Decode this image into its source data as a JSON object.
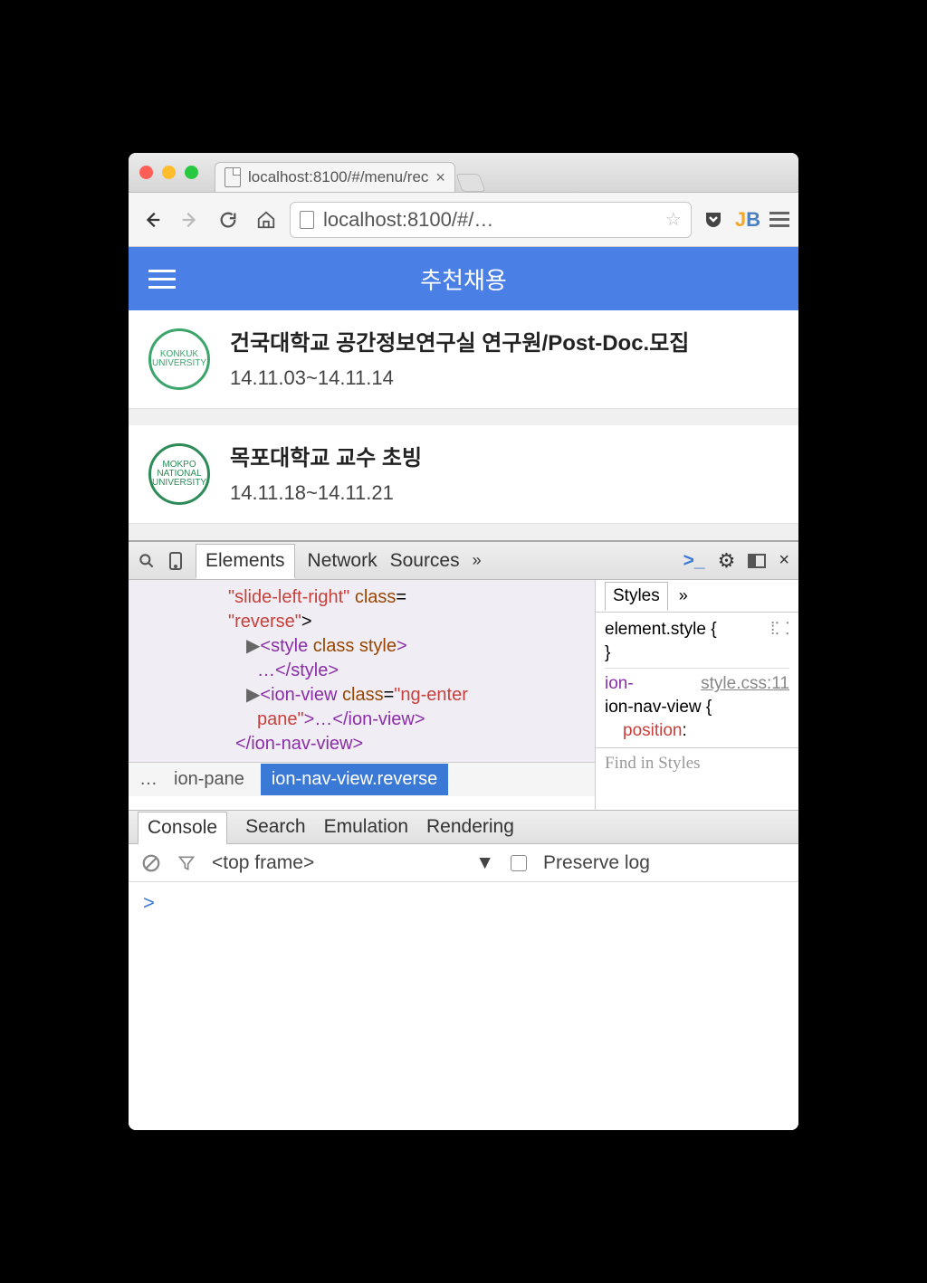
{
  "browser": {
    "tab_title": "localhost:8100/#/menu/rec",
    "url_display": "localhost:8100/#/…"
  },
  "app": {
    "header_title": "추천채용",
    "items": [
      {
        "logo_label": "KONKUK UNIVERSITY",
        "title": "건국대학교 공간정보연구실 연구원/Post-Doc.모집",
        "dates": "14.11.03~14.11.14"
      },
      {
        "logo_label": "MOKPO NATIONAL UNIVERSITY",
        "title": "목포대학교 교수 초빙",
        "dates": "14.11.18~14.11.21"
      }
    ]
  },
  "devtools": {
    "tabs": {
      "elements": "Elements",
      "network": "Network",
      "sources": "Sources"
    },
    "code": {
      "l1a": "\"slide-left-right\"",
      "l1b": "class",
      "l1c": "=",
      "l2a": "\"reverse\"",
      "l2b": ">",
      "l3a": "<style ",
      "l3b": "class style",
      "l3c": ">",
      "l4": "…</style>",
      "l5a": "<ion-view ",
      "l5b": "class",
      "l5c": "=",
      "l5d": "\"ng-enter",
      "l6a": "pane\"",
      "l6b": ">…</ion-view>",
      "l7": "</ion-nav-view>"
    },
    "crumbs": {
      "dots": "…",
      "c1": "ion-pane",
      "c2": "ion-nav-view.reverse"
    },
    "styles": {
      "tab": "Styles",
      "line1": "element.style {",
      "line2": "}",
      "sel": "ion-nav-view {",
      "file": "style.css:11",
      "prop": "position",
      "find": "Find in Styles"
    },
    "drawer": {
      "console": "Console",
      "search": "Search",
      "emulation": "Emulation",
      "rendering": "Rendering"
    },
    "console": {
      "frame": "<top frame>",
      "preserve": "Preserve log",
      "prompt": ">"
    }
  }
}
